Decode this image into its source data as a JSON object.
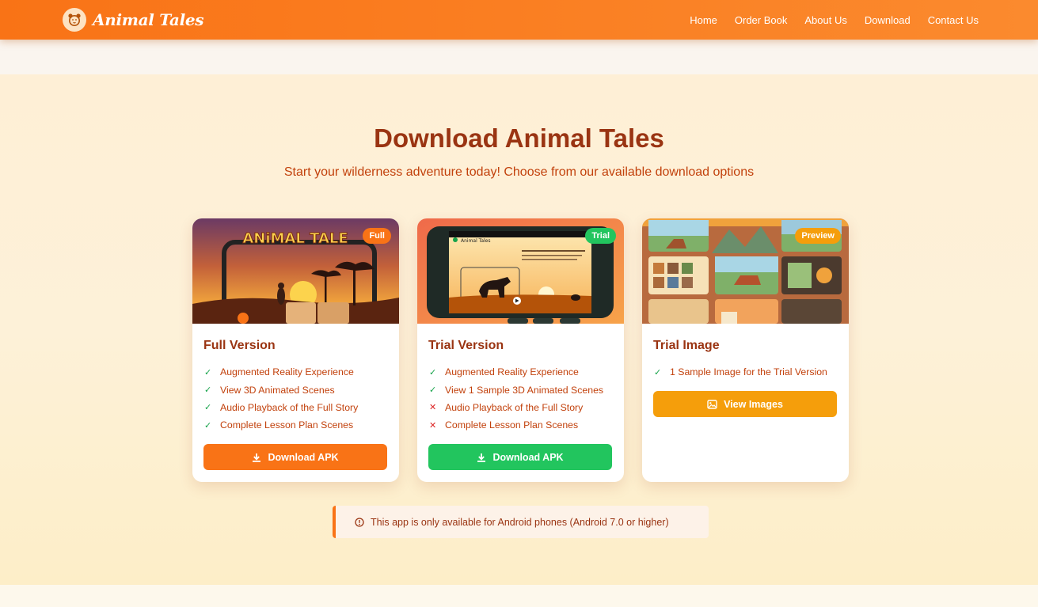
{
  "nav": {
    "brand": "Animal Tales",
    "links": [
      "Home",
      "Order Book",
      "About Us",
      "Download",
      "Contact Us"
    ]
  },
  "section": {
    "title": "Download Animal Tales",
    "subtitle": "Start your wilderness adventure today! Choose from our available download options"
  },
  "cards": [
    {
      "badge": "Full",
      "badge_color": "#f97316",
      "title": "Full Version",
      "image_text": "ANiMAL TALE",
      "features": [
        {
          "text": "Augmented Reality Experience",
          "included": true
        },
        {
          "text": "View 3D Animated Scenes",
          "included": true
        },
        {
          "text": "Audio Playback of the Full Story",
          "included": true
        },
        {
          "text": "Complete Lesson Plan Scenes",
          "included": true
        }
      ],
      "button": "Download APK",
      "button_icon": "download-icon",
      "button_color": "#f97316"
    },
    {
      "badge": "Trial",
      "badge_color": "#22c55e",
      "title": "Trial Version",
      "image_text": "Animal Tales",
      "features": [
        {
          "text": "Augmented Reality Experience",
          "included": true
        },
        {
          "text": "View 1 Sample 3D Animated Scenes",
          "included": true
        },
        {
          "text": "Audio Playback of the Full Story",
          "included": false
        },
        {
          "text": "Complete Lesson Plan Scenes",
          "included": false
        }
      ],
      "button": "Download APK",
      "button_icon": "download-icon",
      "button_color": "#22c55e"
    },
    {
      "badge": "Preview",
      "badge_color": "#f59e0b",
      "title": "Trial Image",
      "features": [
        {
          "text": "1 Sample Image for the Trial Version",
          "included": true
        }
      ],
      "button": "View Images",
      "button_icon": "image-icon",
      "button_color": "#f59e0b"
    }
  ],
  "notice": {
    "icon": "info-icon",
    "text": "This app is only available for Android phones (Android 7.0 or higher)"
  }
}
